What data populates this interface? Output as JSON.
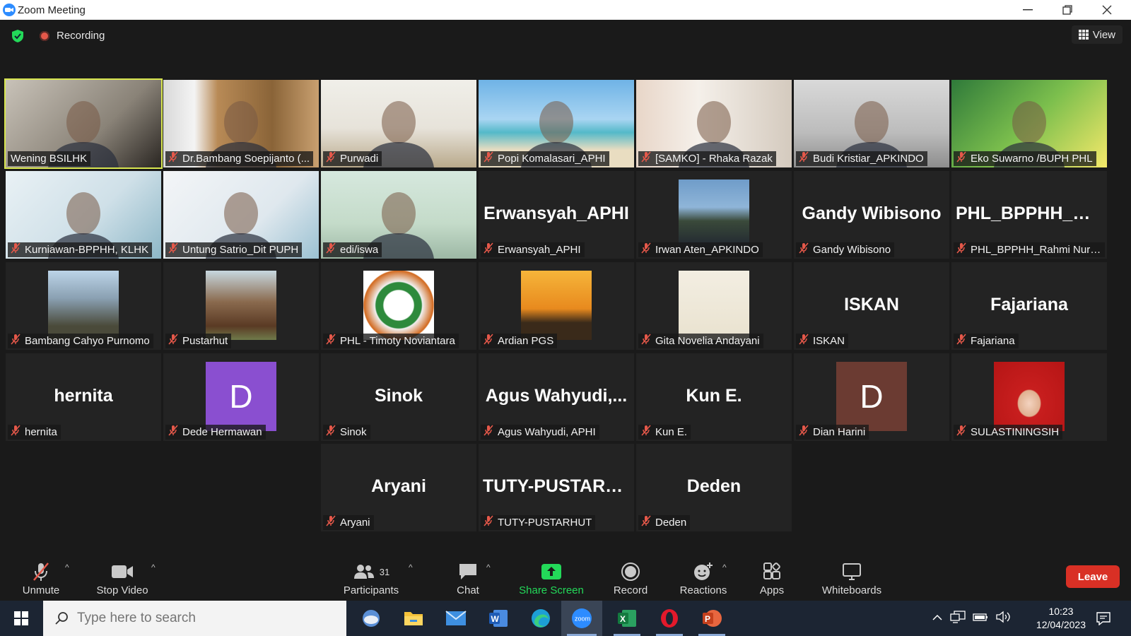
{
  "window": {
    "title": "Zoom Meeting"
  },
  "top": {
    "recording_label": "Recording",
    "view_label": "View"
  },
  "participants": [
    {
      "name": "Wening BSILHK",
      "type": "video",
      "active": true
    },
    {
      "name": "Dr.Bambang Soepijanto (...",
      "type": "video"
    },
    {
      "name": "Purwadi",
      "type": "video"
    },
    {
      "name": "Popi Komalasari_APHI",
      "type": "video"
    },
    {
      "name": "[SAMKO] - Rhaka Razak",
      "type": "video"
    },
    {
      "name": "Budi Kristiar_APKINDO",
      "type": "video"
    },
    {
      "name": "Eko Suwarno /BUPH PHL",
      "type": "video"
    },
    {
      "name": "Kurniawan-BPPHH, KLHK",
      "type": "video"
    },
    {
      "name": "Untung Satrio_Dit PUPH",
      "type": "video"
    },
    {
      "name": "edi/iswa",
      "type": "video"
    },
    {
      "name": "Erwansyah_APHI",
      "type": "name",
      "big": "Erwansyah_APHI"
    },
    {
      "name": "Irwan Aten_APKINDO",
      "type": "photo"
    },
    {
      "name": "Gandy Wibisono",
      "type": "name",
      "big": "Gandy Wibisono"
    },
    {
      "name": "PHL_BPPHH_Rahmi Nurhi...",
      "type": "name",
      "big": "PHL_BPPHH_Ra..."
    },
    {
      "name": "Bambang Cahyo Purnomo",
      "type": "photo"
    },
    {
      "name": "Pustarhut",
      "type": "photo"
    },
    {
      "name": "PHL - Timoty Noviantara",
      "type": "photo"
    },
    {
      "name": "Ardian PGS",
      "type": "photo"
    },
    {
      "name": "Gita Novelia Andayani",
      "type": "photo"
    },
    {
      "name": "ISKAN",
      "type": "name",
      "big": "ISKAN"
    },
    {
      "name": "Fajariana",
      "type": "name",
      "big": "Fajariana"
    },
    {
      "name": "hernita",
      "type": "name",
      "big": "hernita"
    },
    {
      "name": "Dede Hermawan",
      "type": "letter",
      "letter": "D",
      "color": "#8a4fd0"
    },
    {
      "name": "Sinok",
      "type": "name",
      "big": "Sinok"
    },
    {
      "name": "Agus Wahyudi, APHI",
      "type": "name",
      "big": "Agus  Wahyudi,..."
    },
    {
      "name": "Kun E.",
      "type": "name",
      "big": "Kun E."
    },
    {
      "name": "Dian Harini",
      "type": "letter",
      "letter": "D",
      "color": "#6b3b32"
    },
    {
      "name": "SULASTININGSIH",
      "type": "photo"
    },
    {
      "name": "Aryani",
      "type": "name",
      "big": "Aryani"
    },
    {
      "name": "TUTY-PUSTARHUT",
      "type": "name",
      "big": "TUTY-PUSTARH..."
    },
    {
      "name": "Deden",
      "type": "name",
      "big": "Deden"
    }
  ],
  "controls": {
    "unmute": "Unmute",
    "stop_video": "Stop Video",
    "participants": "Participants",
    "participants_count": "31",
    "chat": "Chat",
    "share_screen": "Share Screen",
    "record": "Record",
    "reactions": "Reactions",
    "apps": "Apps",
    "whiteboards": "Whiteboards",
    "leave": "Leave"
  },
  "taskbar": {
    "search_placeholder": "Type here to search",
    "time": "10:23",
    "date": "12/04/2023"
  },
  "colors": {
    "accent_green": "#23d959",
    "leave_red": "#d93025",
    "active_border": "#d8e64f"
  }
}
